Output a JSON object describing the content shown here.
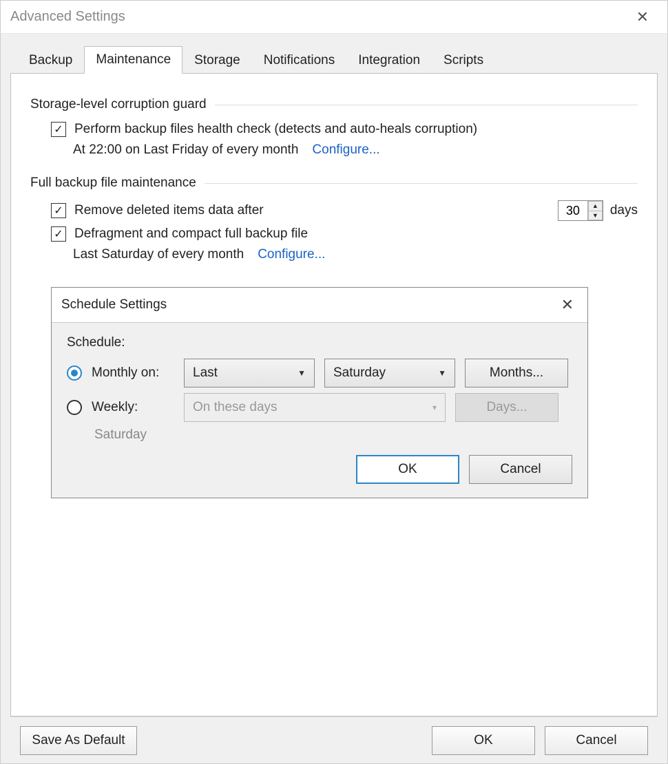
{
  "window": {
    "title": "Advanced Settings"
  },
  "tabs": {
    "items": [
      "Backup",
      "Maintenance",
      "Storage",
      "Notifications",
      "Integration",
      "Scripts"
    ],
    "active_index": 1
  },
  "group1": {
    "heading": "Storage-level corruption guard",
    "check1_label": "Perform backup files health check (detects and auto-heals corruption)",
    "schedule_text": "At 22:00 on Last Friday of every month",
    "configure_label": "Configure..."
  },
  "group2": {
    "heading": "Full backup file maintenance",
    "check1_label": "Remove deleted items data after",
    "days_value": "30",
    "days_suffix": "days",
    "check2_label": "Defragment and compact full backup file",
    "schedule_text": "Last Saturday of every month",
    "configure_label": "Configure..."
  },
  "schedule_dialog": {
    "title": "Schedule Settings",
    "label": "Schedule:",
    "monthly_label": "Monthly on:",
    "monthly_ordinal": "Last",
    "monthly_day": "Saturday",
    "months_button": "Months...",
    "weekly_label": "Weekly:",
    "weekly_placeholder": "On these days",
    "days_button": "Days...",
    "summary": "Saturday",
    "ok": "OK",
    "cancel": "Cancel"
  },
  "footer": {
    "save_default": "Save As Default",
    "ok": "OK",
    "cancel": "Cancel"
  }
}
